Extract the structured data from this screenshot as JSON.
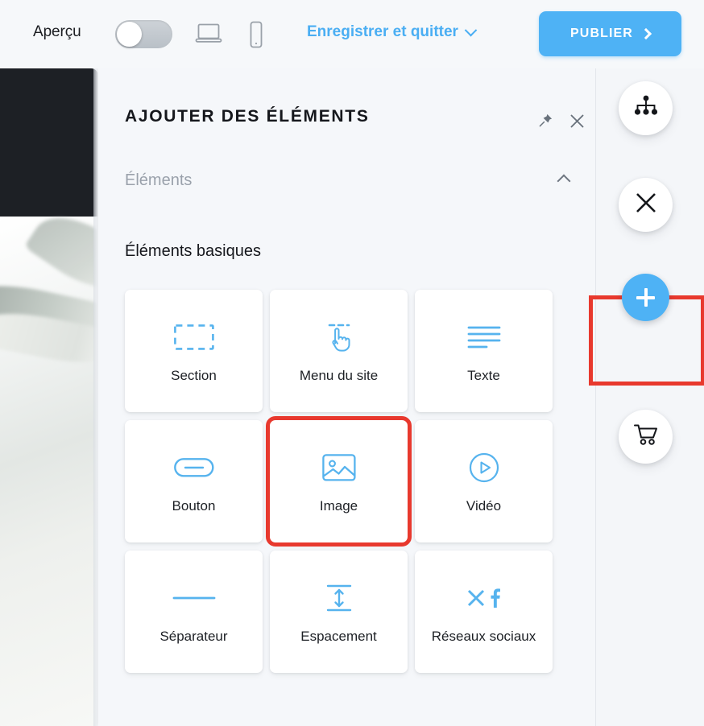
{
  "topbar": {
    "preview_label": "Aperçu",
    "preview_toggle_state": "off",
    "desktop_icon": "desktop-icon",
    "mobile_icon": "mobile-icon",
    "save_exit_label": "Enregistrer et quitter",
    "save_exit_chevron": "chevron-down-icon",
    "publish_label": "PUBLIER",
    "publish_chevron": "chevron-right-icon",
    "accent_blue": "#4eb2f5",
    "background": "#f6f8fa"
  },
  "panel": {
    "title": "AJOUTER DES ÉLÉMENTS",
    "pin_icon": "pin-icon",
    "close_icon": "close-icon",
    "section": {
      "label": "Éléments",
      "chevron": "chevron-up-icon",
      "expanded": true
    },
    "group_title": "Éléments basiques",
    "tiles": [
      {
        "label": "Section",
        "icon": "dashed-rectangle-icon",
        "highlighted": false
      },
      {
        "label": "Menu du site",
        "icon": "pointing-hand-icon",
        "highlighted": false
      },
      {
        "label": "Texte",
        "icon": "text-lines-icon",
        "highlighted": false
      },
      {
        "label": "Bouton",
        "icon": "button-pill-icon",
        "highlighted": false
      },
      {
        "label": "Image",
        "icon": "picture-icon",
        "highlighted": true
      },
      {
        "label": "Vidéo",
        "icon": "play-circle-icon",
        "highlighted": false
      },
      {
        "label": "Séparateur",
        "icon": "horizontal-line-icon",
        "highlighted": false
      },
      {
        "label": "Espacement",
        "icon": "vertical-arrows-icon",
        "highlighted": false
      },
      {
        "label": "Réseaux sociaux",
        "icon": "social-x-facebook-icon",
        "highlighted": false
      }
    ],
    "icon_color": "#56b3ee",
    "background": "#f5f7fa"
  },
  "rail": {
    "buttons": [
      {
        "name": "sitemap",
        "icon": "sitemap-icon",
        "highlighted": false
      },
      {
        "name": "close",
        "icon": "close-x-icon",
        "highlighted": false
      },
      {
        "name": "add",
        "icon": "plus-icon",
        "highlighted": true
      },
      {
        "name": "store",
        "icon": "shopping-cart-icon",
        "highlighted": false
      }
    ],
    "highlight_color": "#e8392e"
  },
  "canvas": {
    "header_color": "#1d2025",
    "photo_description": "pale leaf photograph"
  }
}
